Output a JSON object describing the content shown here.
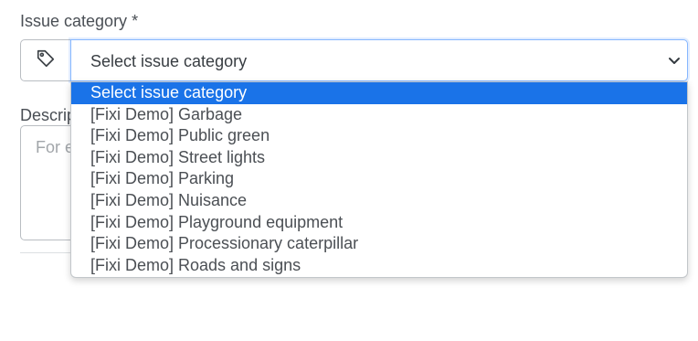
{
  "form": {
    "category_label": "Issue category *",
    "select": {
      "value": "Select issue category",
      "icon_left": "tag-icon",
      "icon_right": "chevron-down-icon"
    },
    "description_label": "Descrip",
    "description_placeholder": "For e"
  },
  "dropdown": {
    "options": [
      "Select issue category",
      "[Fixi Demo] Garbage",
      "[Fixi Demo] Public green",
      "[Fixi Demo] Street lights",
      "[Fixi Demo] Parking",
      "[Fixi Demo] Nuisance",
      "[Fixi Demo] Playground equipment",
      "[Fixi Demo] Processionary caterpillar",
      "[Fixi Demo] Roads and signs"
    ],
    "selected_index": 0
  },
  "colors": {
    "accent": "#1a73e8",
    "focus_border": "#86b7fe"
  }
}
